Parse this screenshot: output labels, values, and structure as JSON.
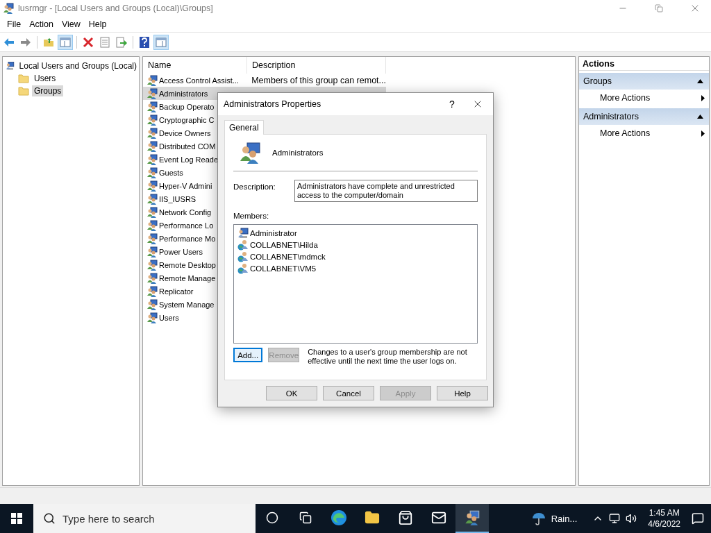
{
  "window": {
    "title": "lusrmgr - [Local Users and Groups (Local)\\Groups]"
  },
  "menu": [
    "File",
    "Action",
    "View",
    "Help"
  ],
  "toolbar": [
    {
      "kind": "back",
      "pressed": false
    },
    {
      "kind": "forward",
      "pressed": false
    },
    {
      "kind": "up",
      "pressed": false
    },
    {
      "kind": "tree",
      "pressed": true
    },
    {
      "kind": "delete",
      "pressed": false
    },
    {
      "kind": "properties",
      "pressed": false
    },
    {
      "kind": "export",
      "pressed": false
    },
    {
      "kind": "help",
      "pressed": false
    },
    {
      "kind": "actionpane",
      "pressed": true
    }
  ],
  "tree": {
    "label": "Local Users and Groups (Local)",
    "children": [
      {
        "label": "Users",
        "selected": false
      },
      {
        "label": "Groups",
        "selected": true
      }
    ]
  },
  "list": {
    "columns": [
      "Name",
      "Description"
    ],
    "rows": [
      {
        "name": "Access Control Assist...",
        "description": "Members of this group can remot...",
        "selected": false
      },
      {
        "name": "Administrators",
        "selected": true
      },
      {
        "name": "Backup Operato",
        "selected": false
      },
      {
        "name": "Cryptographic C",
        "selected": false
      },
      {
        "name": "Device Owners",
        "selected": false
      },
      {
        "name": "Distributed COM",
        "selected": false
      },
      {
        "name": "Event Log Reade",
        "selected": false
      },
      {
        "name": "Guests",
        "selected": false
      },
      {
        "name": "Hyper-V Admini",
        "selected": false
      },
      {
        "name": "IIS_IUSRS",
        "selected": false
      },
      {
        "name": "Network Config",
        "selected": false
      },
      {
        "name": "Performance Lo",
        "selected": false
      },
      {
        "name": "Performance Mo",
        "selected": false
      },
      {
        "name": "Power Users",
        "selected": false
      },
      {
        "name": "Remote Desktop",
        "selected": false
      },
      {
        "name": "Remote Manage",
        "selected": false
      },
      {
        "name": "Replicator",
        "selected": false
      },
      {
        "name": "System Manage",
        "selected": false
      },
      {
        "name": "Users",
        "selected": false
      }
    ]
  },
  "actions": {
    "title": "Actions",
    "sections": [
      {
        "header": "Groups",
        "items": [
          "More Actions"
        ]
      },
      {
        "header": "Administrators",
        "items": [
          "More Actions"
        ]
      }
    ]
  },
  "dialog": {
    "title": "Administrators Properties",
    "help": "?",
    "tabs": [
      {
        "label": "General",
        "selected": true
      }
    ],
    "group_name": "Administrators",
    "description_label": "Description:",
    "description": "Administrators have complete and unrestricted access to the computer/domain",
    "members_label": "Members:",
    "members": [
      {
        "name": "Administrator",
        "kind": "local"
      },
      {
        "name": "COLLABNET\\Hilda",
        "kind": "domain"
      },
      {
        "name": "COLLABNET\\mdmck",
        "kind": "domain"
      },
      {
        "name": "COLLABNET\\VM5",
        "kind": "domain"
      }
    ],
    "member_buttons": [
      {
        "label": "Add...",
        "disabled": false,
        "focused": true
      },
      {
        "label": "Remove",
        "disabled": true,
        "focused": false
      }
    ],
    "note": "Changes to a user's group membership are not effective until the next time the user logs on.",
    "buttons": [
      {
        "label": "OK",
        "disabled": false
      },
      {
        "label": "Cancel",
        "disabled": false
      },
      {
        "label": "Apply",
        "disabled": true
      },
      {
        "label": "Help",
        "disabled": false
      }
    ]
  },
  "taskbar": {
    "search_placeholder": "Type here to search",
    "apps": [
      {
        "kind": "cortana",
        "active": false
      },
      {
        "kind": "taskview",
        "active": false
      },
      {
        "kind": "edge",
        "active": false
      },
      {
        "kind": "explorer",
        "active": false
      },
      {
        "kind": "store",
        "active": false
      },
      {
        "kind": "mail",
        "active": false
      },
      {
        "kind": "lusrmgr",
        "active": true
      }
    ],
    "weather": "Rain...",
    "time": "1:45 AM",
    "date": "4/6/2022"
  }
}
